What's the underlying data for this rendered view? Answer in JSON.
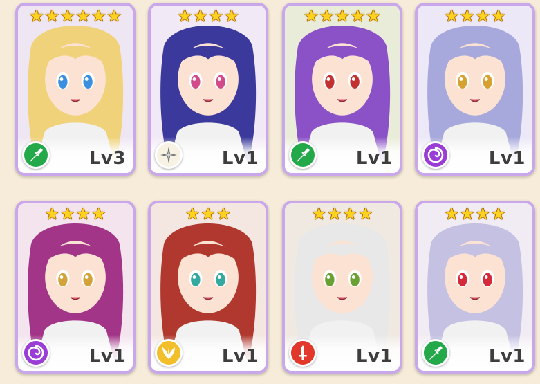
{
  "cards": [
    {
      "stars": 6,
      "class_icon": "lance-icon",
      "class_color": "#23a94a",
      "level": "Lv3",
      "palette": {
        "hair": "#f0d27a",
        "eyes": "#3a8fe0",
        "bg": "#efe6f4"
      }
    },
    {
      "stars": 4,
      "class_icon": "compass-icon",
      "class_color": "#f7f2e4",
      "level": "Lv1",
      "palette": {
        "hair": "#3b3a9c",
        "eyes": "#d34a8a",
        "bg": "#f2e9f6"
      }
    },
    {
      "stars": 5,
      "class_icon": "lance-icon",
      "class_color": "#23a94a",
      "level": "Lv1",
      "palette": {
        "hair": "#8b52c7",
        "eyes": "#c23030",
        "bg": "#e9ecd8"
      }
    },
    {
      "stars": 4,
      "class_icon": "spiral-icon",
      "class_color": "#9a3cd6",
      "level": "Lv1",
      "palette": {
        "hair": "#a7a9dc",
        "eyes": "#d5a232",
        "bg": "#ece8f8"
      }
    },
    {
      "stars": 4,
      "class_icon": "spiral-icon",
      "class_color": "#9a3cd6",
      "level": "Lv1",
      "palette": {
        "hair": "#a23588",
        "eyes": "#d2a33a",
        "bg": "#f3e4ee"
      }
    },
    {
      "stars": 3,
      "class_icon": "wings-icon",
      "class_color": "#f2be2a",
      "level": "Lv1",
      "palette": {
        "hair": "#b0382e",
        "eyes": "#33a9a0",
        "bg": "#f4e7e2"
      }
    },
    {
      "stars": 4,
      "class_icon": "sword-icon",
      "class_color": "#e2382c",
      "level": "Lv1",
      "palette": {
        "hair": "#e8e8e8",
        "eyes": "#6aa034",
        "bg": "#efe9e2"
      }
    },
    {
      "stars": 4,
      "class_icon": "lance-icon",
      "class_color": "#23a94a",
      "level": "Lv1",
      "palette": {
        "hair": "#c4c1e2",
        "eyes": "#d42a3a",
        "bg": "#f1ecf3"
      }
    }
  ]
}
